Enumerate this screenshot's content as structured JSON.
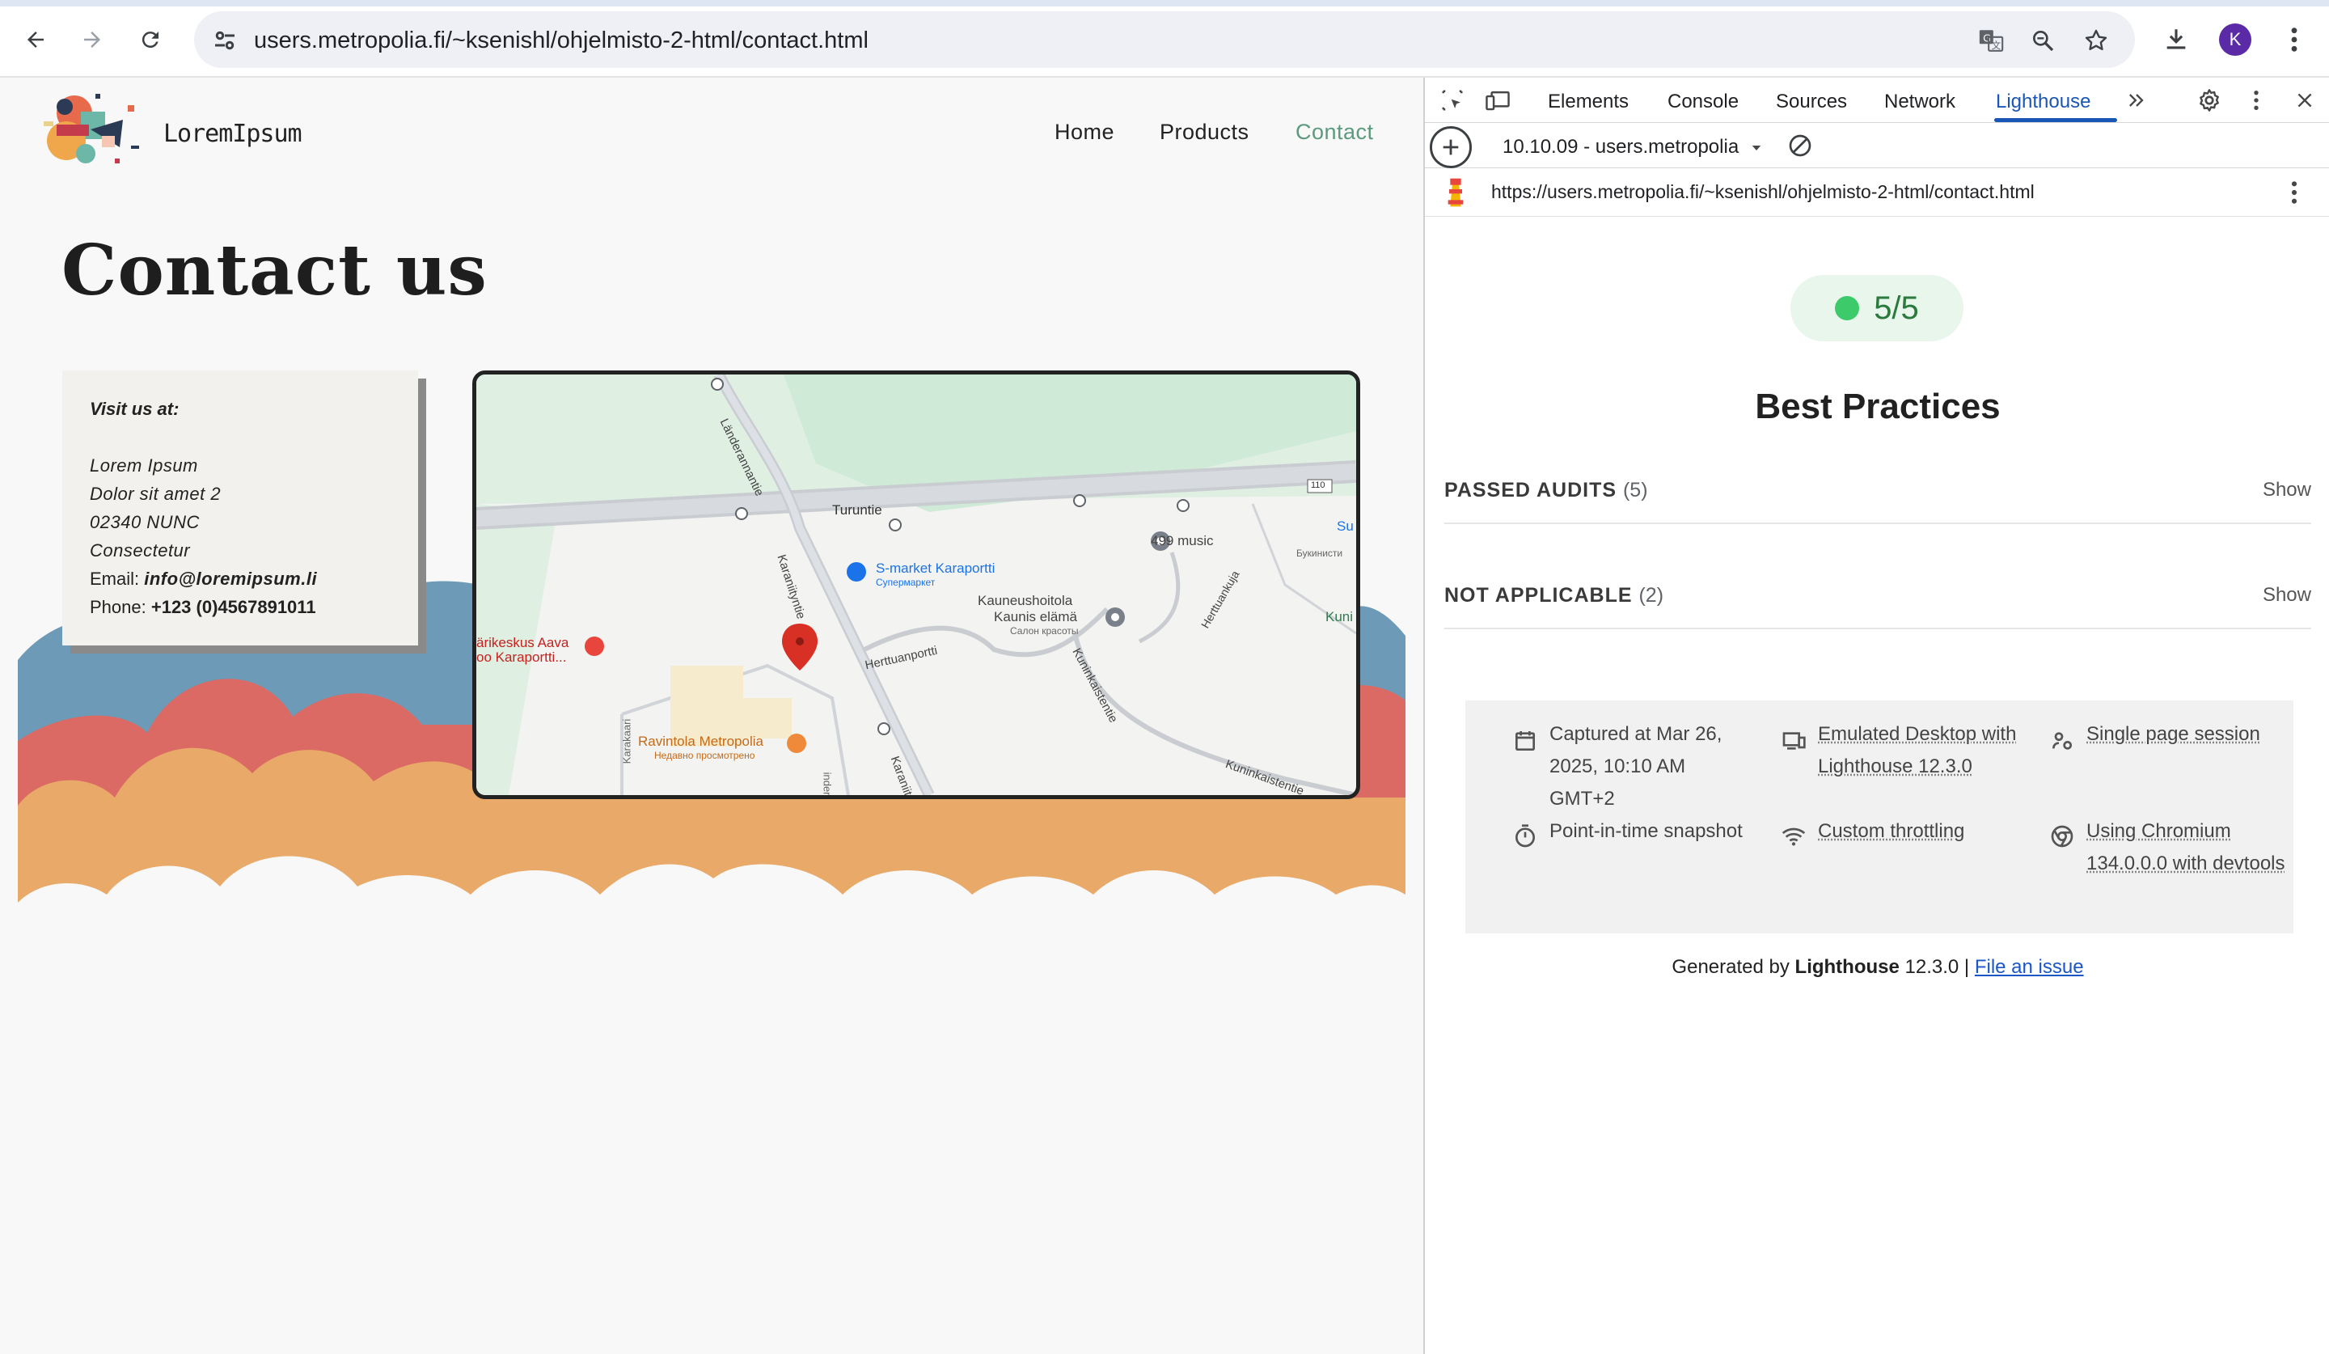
{
  "browser": {
    "url": "users.metropolia.fi/~ksenishl/ohjelmisto-2-html/contact.html",
    "back_icon": "arrow-left-icon",
    "forward_icon": "arrow-right-icon",
    "reload_icon": "reload-icon",
    "avatar_initial": "K"
  },
  "site": {
    "brand": "LoremIpsum",
    "nav": [
      "Home",
      "Products",
      "Contact"
    ],
    "active_nav": "Contact",
    "active_color": "#5a9a7e",
    "title": "Contact us"
  },
  "contact_card": {
    "visit_label": "Visit us at:",
    "address": [
      "Lorem Ipsum",
      "Dolor sit amet 2",
      "02340 NUNC",
      "Consectetur"
    ],
    "email_label": "Email:",
    "email": "info@loremipsum.li",
    "phone_label": "Phone:",
    "phone": "+123 (0)4567891011"
  },
  "map": {
    "labels": {
      "turuntie": "Turuntie",
      "smarket": "S-market Karaportti",
      "smarket_sub": "Супермаркет",
      "music": "499 music",
      "bukinist": "Букинисти",
      "su": "Su",
      "kuni": "Kuni",
      "kauneus1": "Kauneushoitola",
      "kauneus2": "Kaunis elämä",
      "kauneus_sub": "Салон красоты",
      "herttuankuja": "Herttuankuja",
      "herttuanportti": "Herttuanportti",
      "kuninkaistentie": "Kuninkaistentie",
      "kuninkaistentie2": "Kuninkaistentie",
      "karaniityntie": "Karaniityntie",
      "karaniitty2": "Karaniit",
      "landeranta": "Länderannantie",
      "laakari1": "ärikeskus Aava",
      "laakari2": "oo Karaportti...",
      "ravintola": "Ravintola Metropolia",
      "ravintola_sub": "Недавно просмотрено",
      "karakaari": "Karakaari",
      "linden": "inden",
      "road110": "110"
    }
  },
  "devtools": {
    "tabs": [
      "Elements",
      "Console",
      "Sources",
      "Network",
      "Lighthouse"
    ],
    "active_tab": "Lighthouse",
    "report": "10.10.09 - users.metropolia",
    "report_url": "https://users.metropolia.fi/~ksenishl/ohjelmisto-2-html/contact.html",
    "score": "5/5",
    "score_color": "#3dca6b",
    "category": "Best Practices",
    "audits": [
      {
        "label": "PASSED AUDITS",
        "count": "(5)",
        "action": "Show"
      },
      {
        "label": "NOT APPLICABLE",
        "count": "(2)",
        "action": "Show"
      }
    ],
    "meta": {
      "captured": "Captured at Mar 26, 2025, 10:10 AM GMT+2",
      "emulated": "Emulated Desktop with Lighthouse 12.3.0",
      "session": "Single page session",
      "snapshot": "Point-in-time snapshot",
      "throttling": "Custom throttling",
      "chromium": "Using Chromium 134.0.0.0 with devtools"
    },
    "footer": {
      "prefix": "Generated by",
      "tool": "Lighthouse",
      "version": "12.3.0 |",
      "link": "File an issue"
    }
  }
}
